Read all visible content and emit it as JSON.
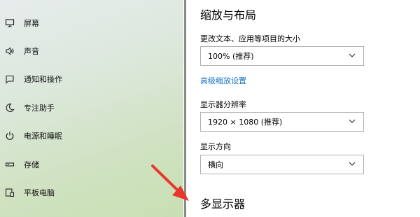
{
  "sidebar": {
    "items": [
      {
        "label": "屏幕",
        "icon": "monitor-icon"
      },
      {
        "label": "声音",
        "icon": "speaker-icon"
      },
      {
        "label": "通知和操作",
        "icon": "notification-icon"
      },
      {
        "label": "专注助手",
        "icon": "moon-icon"
      },
      {
        "label": "电源和睡眠",
        "icon": "power-icon"
      },
      {
        "label": "存储",
        "icon": "storage-icon"
      },
      {
        "label": "平板电脑",
        "icon": "tablet-icon"
      }
    ]
  },
  "main": {
    "section_title": "缩放与布局",
    "scale_label": "更改文本、应用等项目的大小",
    "scale_value": "100% (推荐)",
    "advanced_link": "高级缩放设置",
    "resolution_label": "显示器分辨率",
    "resolution_value": "1920 × 1080 (推荐)",
    "orientation_label": "显示方向",
    "orientation_value": "横向",
    "multi_display_title": "多显示器"
  },
  "colors": {
    "link": "#1a74c6",
    "arrow": "#e8382c"
  },
  "icons": {
    "dropdown": "chevron-down-icon",
    "annotation": "red-arrow-icon"
  }
}
